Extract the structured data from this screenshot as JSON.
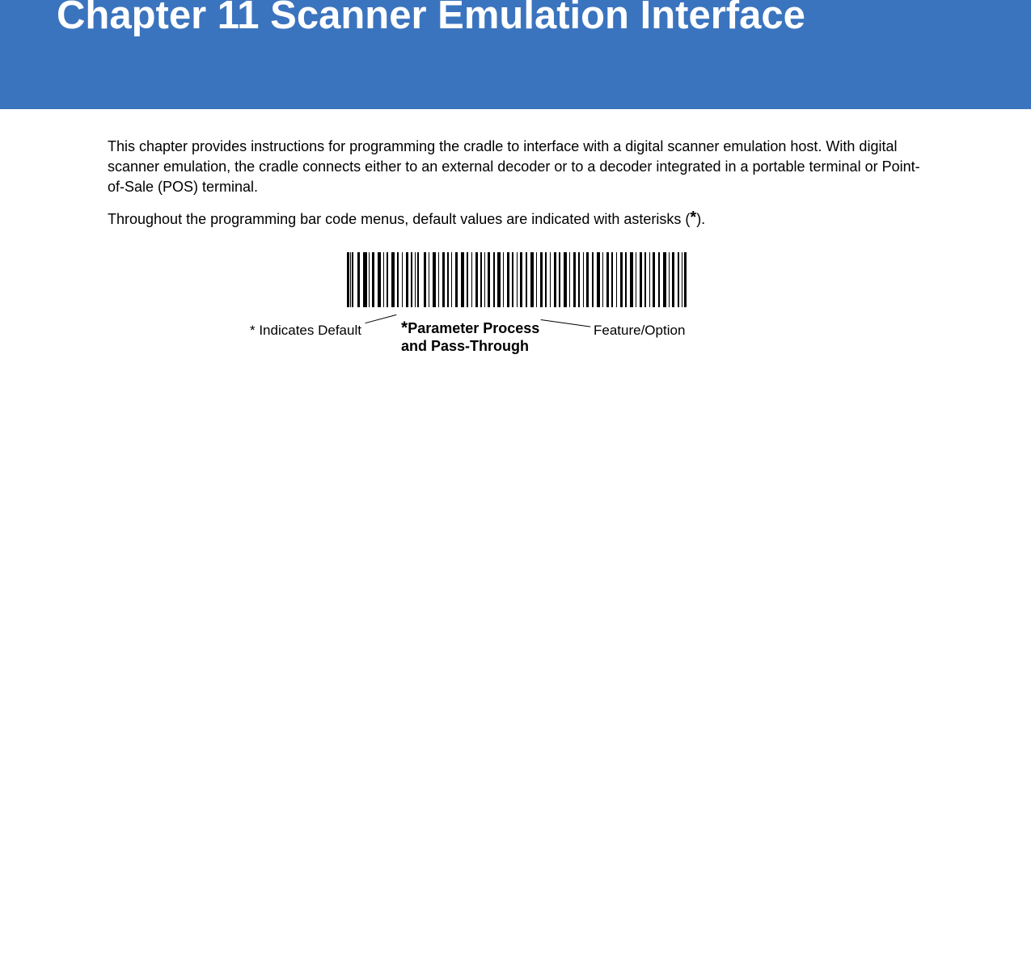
{
  "header": {
    "title": "Chapter 11 Scanner Emulation Interface"
  },
  "body": {
    "paragraph1": "This chapter provides instructions for programming the cradle to interface with a digital scanner emulation host. With digital scanner emulation, the cradle connects either to an external decoder or to a decoder integrated in a portable terminal or Point-of-Sale (POS) terminal.",
    "paragraph2_prefix": "Throughout the programming bar code menus, default values are indicated with asterisks (",
    "paragraph2_asterisk": "*",
    "paragraph2_suffix": ")."
  },
  "barcode": {
    "annotation_left": "* Indicates Default",
    "annotation_center_asterisk": "*",
    "annotation_center_line1": "Parameter Process",
    "annotation_center_line2": "and Pass-Through",
    "annotation_right": "Feature/Option"
  }
}
